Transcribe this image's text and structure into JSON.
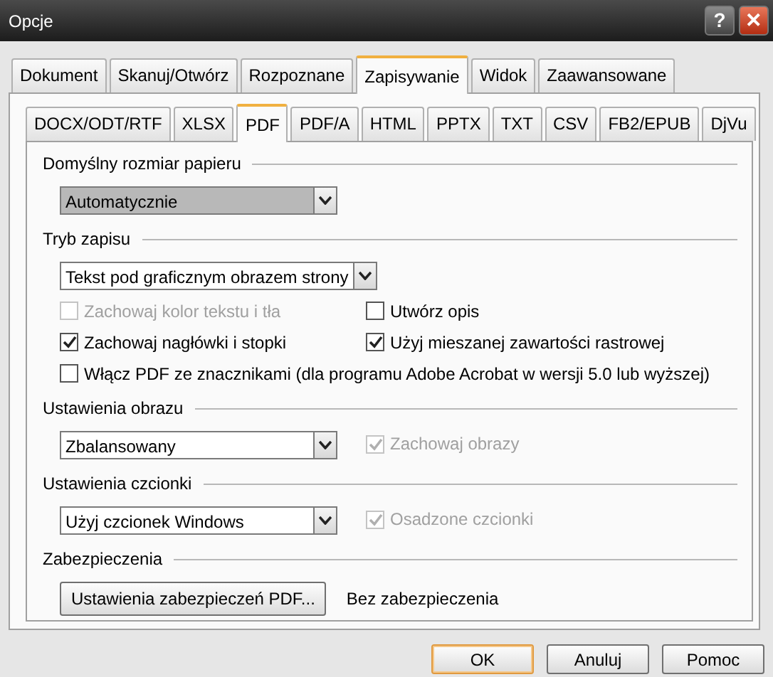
{
  "window": {
    "title": "Opcje",
    "controls": [
      {
        "kind": "help",
        "label": "?"
      },
      {
        "kind": "close",
        "label": "✕"
      }
    ]
  },
  "tabs": [
    {
      "label": "Dokument",
      "selected": false
    },
    {
      "label": "Skanuj/Otwórz",
      "selected": false
    },
    {
      "label": "Rozpoznane",
      "selected": false
    },
    {
      "label": "Zapisywanie",
      "selected": true
    },
    {
      "label": "Widok",
      "selected": false
    },
    {
      "label": "Zaawansowane",
      "selected": false
    }
  ],
  "subtabs": [
    {
      "label": "DOCX/ODT/RTF",
      "selected": false
    },
    {
      "label": "XLSX",
      "selected": false
    },
    {
      "label": "PDF",
      "selected": true
    },
    {
      "label": "PDF/A",
      "selected": false
    },
    {
      "label": "HTML",
      "selected": false
    },
    {
      "label": "PPTX",
      "selected": false
    },
    {
      "label": "TXT",
      "selected": false
    },
    {
      "label": "CSV",
      "selected": false
    },
    {
      "label": "FB2/EPUB",
      "selected": false
    },
    {
      "label": "DjVu",
      "selected": false
    }
  ],
  "sections": [
    {
      "title": "Domyślny rozmiar papieru",
      "rows": [
        [
          {
            "kind": "dropdown",
            "value": "Automatycznie",
            "focused": true
          }
        ]
      ]
    },
    {
      "title": "Tryb zapisu",
      "rows": [
        [
          {
            "kind": "dropdown",
            "value": "Tekst pod graficznym obrazem strony",
            "focused": false
          }
        ],
        [
          {
            "kind": "checkbox",
            "label": "Zachowaj kolor tekstu i tła",
            "checked": false,
            "disabled": true
          },
          {
            "kind": "checkbox",
            "label": "Utwórz opis",
            "checked": false,
            "disabled": false
          }
        ],
        [
          {
            "kind": "checkbox",
            "label": "Zachowaj nagłówki i stopki",
            "checked": true,
            "disabled": false
          },
          {
            "kind": "checkbox",
            "label": "Użyj mieszanej zawartości rastrowej",
            "checked": true,
            "disabled": false
          }
        ],
        [
          {
            "kind": "checkbox",
            "label": "Włącz PDF ze znacznikami (dla programu Adobe Acrobat w wersji  5.0 lub wyższej)",
            "checked": false,
            "disabled": false
          }
        ]
      ]
    },
    {
      "title": "Ustawienia obrazu",
      "rows": [
        [
          {
            "kind": "dropdown",
            "value": "Zbalansowany",
            "focused": false
          },
          {
            "kind": "checkbox",
            "label": "Zachowaj obrazy",
            "checked": true,
            "disabled": true
          }
        ]
      ]
    },
    {
      "title": "Ustawienia czcionki",
      "rows": [
        [
          {
            "kind": "dropdown",
            "value": "Użyj czcionek Windows",
            "focused": false
          },
          {
            "kind": "checkbox",
            "label": "Osadzone czcionki",
            "checked": true,
            "disabled": true
          }
        ]
      ]
    },
    {
      "title": "Zabezpieczenia",
      "rows": [
        [
          {
            "kind": "button",
            "label": "Ustawienia zabezpieczeń PDF..."
          },
          {
            "kind": "text",
            "label": "Bez zabezpieczenia"
          }
        ]
      ]
    }
  ],
  "buttons": [
    {
      "label": "OK",
      "default": true
    },
    {
      "label": "Anuluj",
      "default": false
    },
    {
      "label": "Pomoc",
      "default": false
    }
  ]
}
